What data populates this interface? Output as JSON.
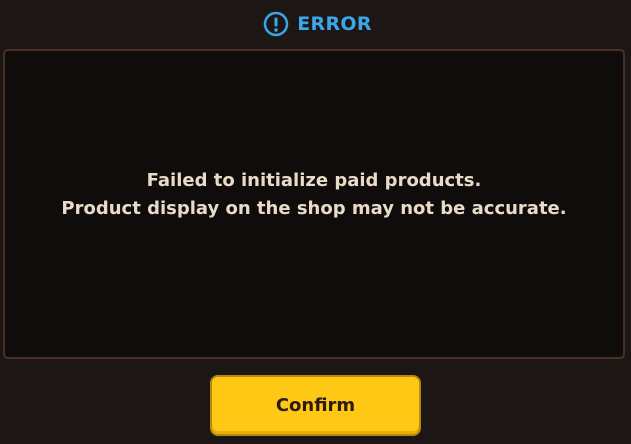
{
  "dialog": {
    "title": "ERROR",
    "icon": "exclamation-circle-icon",
    "message_lines": [
      "Failed to initialize paid products.",
      "Product display on the shop may not be accurate."
    ],
    "confirm_label": "Confirm"
  },
  "colors": {
    "title": "#3aa8e8",
    "background": "#1c1714",
    "panel": "#0f0c0b",
    "panel_border": "#4a2f22",
    "message_text": "#e8dcc8",
    "button": "#ffc814",
    "button_text": "#2a1d10"
  }
}
